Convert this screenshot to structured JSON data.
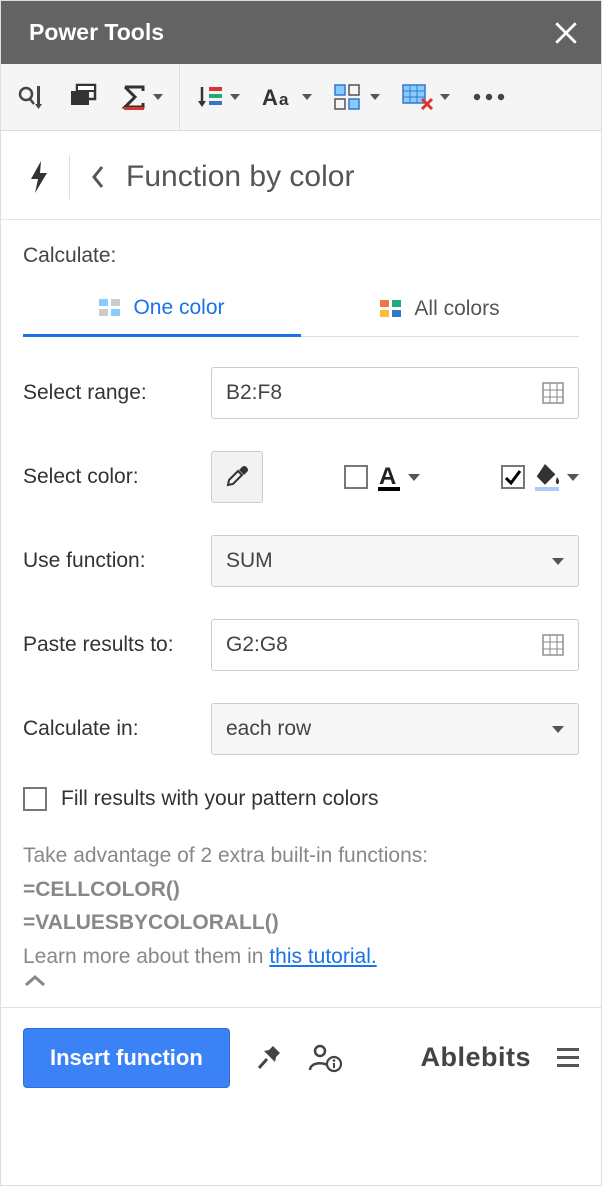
{
  "header": {
    "title": "Power Tools"
  },
  "crumb": {
    "title": "Function by color"
  },
  "labels": {
    "calculate": "Calculate:",
    "select_range": "Select range:",
    "select_color": "Select color:",
    "use_function": "Use function:",
    "paste_results": "Paste results to:",
    "calculate_in": "Calculate in:"
  },
  "tabs": {
    "one_color": "One color",
    "all_colors": "All colors"
  },
  "fields": {
    "range": "B2:F8",
    "function": "SUM",
    "paste_to": "G2:G8",
    "calc_in": "each row"
  },
  "options": {
    "fill_results_label": "Fill results with your pattern colors"
  },
  "hint": {
    "line1": "Take advantage of 2 extra built-in functions:",
    "fn1": "=CELLCOLOR()",
    "fn2": "=VALUESBYCOLORALL()",
    "line2_pre": "Learn more about them in ",
    "link": "this tutorial."
  },
  "footer": {
    "insert": "Insert function",
    "brand": "Ablebits"
  }
}
